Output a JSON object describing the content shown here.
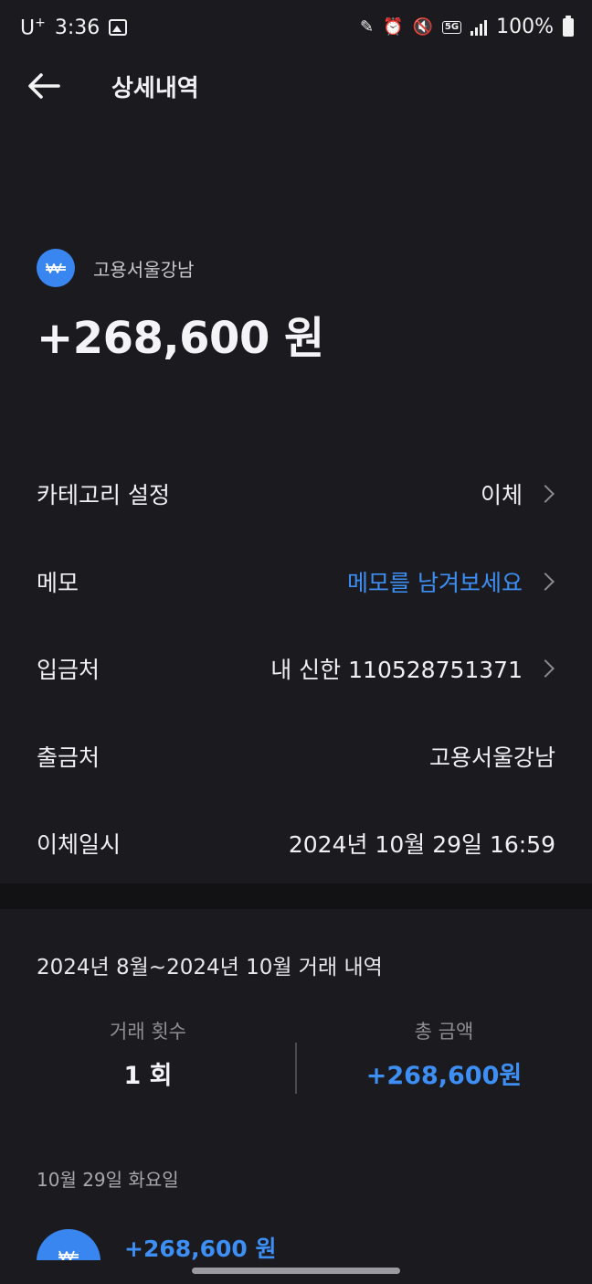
{
  "status_bar": {
    "carrier": "U",
    "carrier_suffix": "+",
    "time": "3:36",
    "battery": "100%",
    "network": "5G"
  },
  "header": {
    "title": "상세내역"
  },
  "summary": {
    "merchant": "고용서울강남",
    "amount": "+268,600 원",
    "logo_icon": "won-icon"
  },
  "details": {
    "category": {
      "label": "카테고리 설정",
      "value": "이체"
    },
    "memo": {
      "label": "메모",
      "value": "메모를 남겨보세요"
    },
    "deposit": {
      "label": "입금처",
      "value": "내 신한 110528751371"
    },
    "withdraw": {
      "label": "출금처",
      "value": "고용서울강남"
    },
    "datetime": {
      "label": "이체일시",
      "value": "2024년 10월 29일 16:59"
    }
  },
  "history": {
    "title": "2024년 8월~2024년 10월 거래 내역",
    "count_label": "거래 횟수",
    "count_value": "1 회",
    "total_label": "총 금액",
    "total_value": "+268,600원",
    "date_header": "10월 29일 화요일",
    "items": [
      {
        "amount": "+268,600 원"
      }
    ]
  },
  "colors": {
    "background": "#1b1b1f",
    "accent_blue": "#3d8ff5",
    "logo_blue": "#3a86f0"
  }
}
